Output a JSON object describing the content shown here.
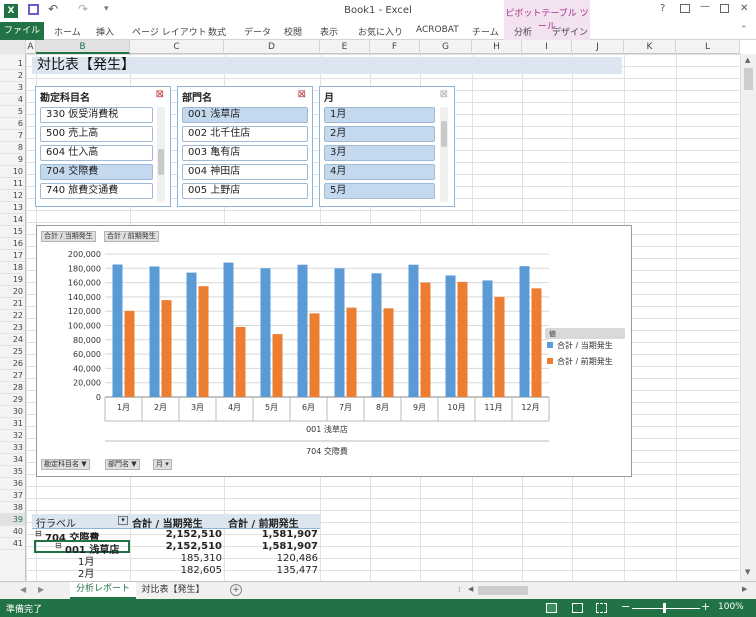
{
  "app": {
    "title": "Book1 - Excel",
    "help": "?",
    "minimize": "—",
    "close": "✕"
  },
  "ribbon": {
    "file": "ファイル",
    "tabs": [
      "ホーム",
      "挿入",
      "ページ レイアウト",
      "数式",
      "データ",
      "校閲",
      "表示",
      "お気に入り",
      "ACROBAT",
      "チーム",
      "分析",
      "デザイン"
    ],
    "context_group": "ピボットテーブル ツール"
  },
  "columns": [
    "A",
    "B",
    "C",
    "D",
    "E",
    "F",
    "G",
    "H",
    "I",
    "J",
    "K",
    "L"
  ],
  "rows": [
    "1",
    "2",
    "3",
    "4",
    "5",
    "6",
    "7",
    "8",
    "9",
    "10",
    "11",
    "12",
    "13",
    "14",
    "15",
    "16",
    "17",
    "18",
    "19",
    "20",
    "21",
    "22",
    "23",
    "24",
    "25",
    "26",
    "27",
    "28",
    "29",
    "30",
    "31",
    "32",
    "33",
    "34",
    "35",
    "36",
    "37",
    "38",
    "39",
    "40",
    "41"
  ],
  "sheet_title": "対比表【発生】",
  "slicers": [
    {
      "title": "勘定科目名",
      "items": [
        "330 仮受消費税",
        "500 売上高",
        "604 仕入高",
        "704 交際費",
        "740 旅費交通費"
      ],
      "selected": [
        3
      ]
    },
    {
      "title": "部門名",
      "items": [
        "001 浅草店",
        "002 北千住店",
        "003 亀有店",
        "004 神田店",
        "005 上野店"
      ],
      "selected": [
        0
      ]
    },
    {
      "title": "月",
      "items": [
        "1月",
        "2月",
        "3月",
        "4月",
        "5月"
      ],
      "selected": [
        0,
        1,
        2,
        3,
        4
      ]
    }
  ],
  "chart_chips": {
    "top": [
      "合計 / 当期発生",
      "合計 / 前期発生"
    ],
    "bottom": [
      "勘定科目名",
      "部門名",
      "月"
    ]
  },
  "legend_title": "値",
  "chart_data": {
    "type": "bar",
    "categories": [
      "1月",
      "2月",
      "3月",
      "4月",
      "5月",
      "6月",
      "7月",
      "8月",
      "9月",
      "10月",
      "11月",
      "12月"
    ],
    "series": [
      {
        "name": "合計 / 当期発生",
        "color": "#5b9bd5",
        "values": [
          185310,
          182605,
          174000,
          188000,
          180000,
          185000,
          180000,
          173000,
          185000,
          170000,
          163000,
          183000
        ]
      },
      {
        "name": "合計 / 前期発生",
        "color": "#ed7d31",
        "values": [
          120486,
          135477,
          155000,
          98000,
          88000,
          117000,
          125000,
          124000,
          160000,
          161000,
          140000,
          152000
        ]
      }
    ],
    "yticks": [
      "0",
      "20,000",
      "40,000",
      "60,000",
      "80,000",
      "100,000",
      "120,000",
      "140,000",
      "160,000",
      "180,000",
      "200,000"
    ],
    "ylim": [
      0,
      200000
    ],
    "xlabel_1": "001 浅草店",
    "xlabel_2": "704 交際費",
    "legend_position": "right",
    "grid": true
  },
  "pivot": {
    "headers": [
      "行ラベル",
      "合計 / 当期発生",
      "合計 / 前期発生"
    ],
    "rows": [
      {
        "label": "704 交際費",
        "cur": "2,152,510",
        "prev": "1,581,907",
        "bold": true
      },
      {
        "label": "001 浅草店",
        "cur": "2,152,510",
        "prev": "1,581,907",
        "bold": true
      },
      {
        "label": "1月",
        "cur": "185,310",
        "prev": "120,486",
        "bold": false
      },
      {
        "label": "2月",
        "cur": "182,605",
        "prev": "135,477",
        "bold": false
      }
    ]
  },
  "sheet_tabs": [
    "分析レポート",
    "対比表【発生】"
  ],
  "status": {
    "ready": "準備完了",
    "zoom": "100%"
  }
}
